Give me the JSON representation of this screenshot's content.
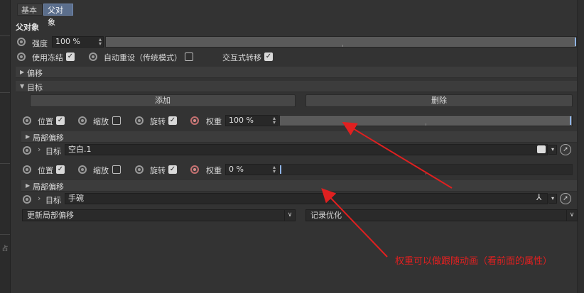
{
  "tabs": [
    {
      "label": "基本"
    },
    {
      "label": "父对象"
    }
  ],
  "section_title": "父对象",
  "strength": {
    "label": "强度",
    "value": "100 %"
  },
  "options": {
    "freeze_label": "使用冻结",
    "auto_reset_label": "自动重设（传统模式）",
    "interactive_label": "交互式转移"
  },
  "groups": {
    "offset": "偏移",
    "target": "目标"
  },
  "buttons": {
    "add": "添加",
    "delete": "删除"
  },
  "targets": [
    {
      "position_label": "位置",
      "scale_label": "缩放",
      "rotation_label": "旋转",
      "weight_label": "权重",
      "weight_value": "100 %",
      "weight_fraction": 1.0,
      "local_offset_label": "局部偏移",
      "target_label": "目标",
      "target_value": "空白.1"
    },
    {
      "position_label": "位置",
      "scale_label": "缩放",
      "rotation_label": "旋转",
      "weight_label": "权重",
      "weight_value": "0 %",
      "weight_fraction": 0.0,
      "local_offset_label": "局部偏移",
      "target_label": "目标",
      "target_value": "手碗"
    }
  ],
  "bottom": {
    "update_local_offset": "更新局部偏移",
    "record_optimize": "记录优化"
  },
  "annotation": {
    "text": "权重可以做跟随动画（看前面的属性）",
    "color": "#e02020"
  },
  "colors": {
    "accent": "#5b6e8c",
    "slider_thumb": "#8fb4e6",
    "keyframe_active": "#c57070"
  },
  "left_strip_glyph": "占"
}
